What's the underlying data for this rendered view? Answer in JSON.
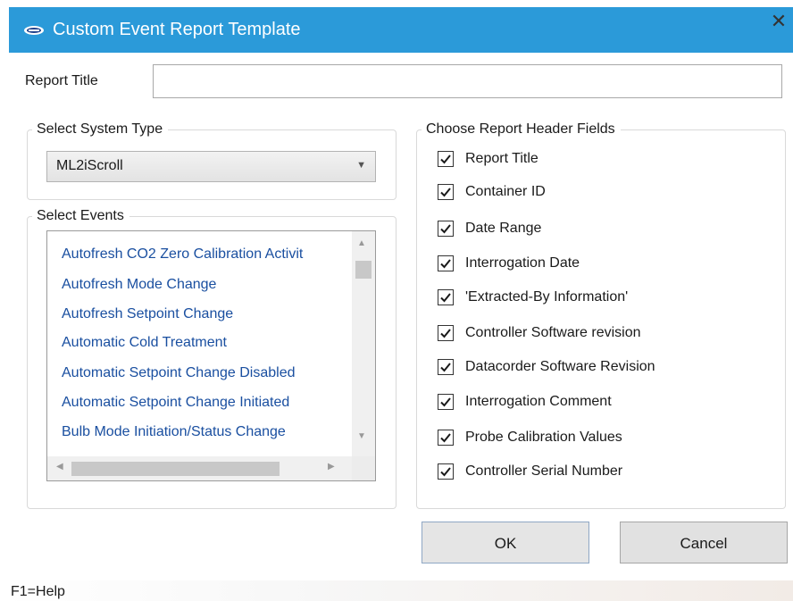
{
  "window": {
    "title": "Custom Event Report Template",
    "close_glyph": "✕"
  },
  "report_title": {
    "label": "Report Title",
    "value": "",
    "placeholder": ""
  },
  "system_type": {
    "label": "Select System Type",
    "selected": "ML2iScroll"
  },
  "events": {
    "label": "Select Events",
    "items": [
      "Autofresh CO2 Zero Calibration Activit",
      "Autofresh Mode Change",
      "Autofresh Setpoint Change",
      "Automatic Cold Treatment",
      "Automatic Setpoint Change Disabled",
      "Automatic Setpoint Change Initiated",
      "Bulb Mode Initiation/Status Change"
    ]
  },
  "header_fields": {
    "label": "Choose Report Header Fields",
    "items": [
      {
        "label": "Report Title",
        "checked": true
      },
      {
        "label": "Container ID",
        "checked": true
      },
      {
        "label": "Date Range",
        "checked": true
      },
      {
        "label": "Interrogation Date",
        "checked": true
      },
      {
        "label": "'Extracted-By Information'",
        "checked": true
      },
      {
        "label": "Controller Software revision",
        "checked": true
      },
      {
        "label": "Datacorder Software Revision",
        "checked": true
      },
      {
        "label": "Interrogation Comment",
        "checked": true
      },
      {
        "label": "Probe Calibration Values",
        "checked": true
      },
      {
        "label": "Controller Serial Number",
        "checked": true
      }
    ]
  },
  "buttons": {
    "ok": "OK",
    "cancel": "Cancel"
  },
  "status": {
    "help": "F1=Help"
  },
  "colors": {
    "titlebar": "#2b9ad9",
    "list_text": "#1a4fa0"
  }
}
